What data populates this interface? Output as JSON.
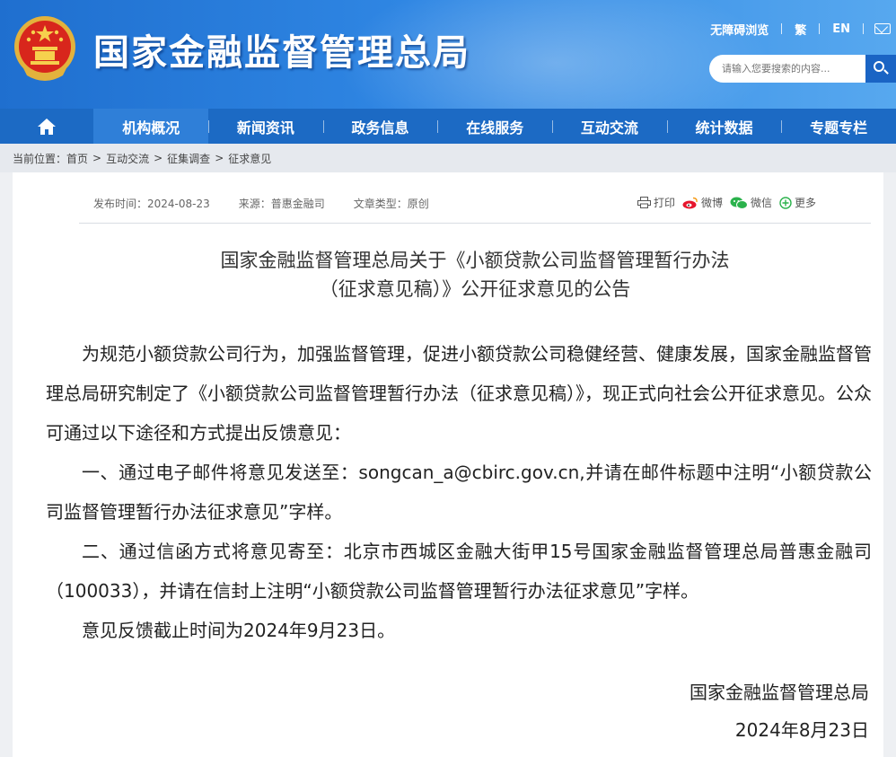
{
  "header": {
    "site_title": "国家金融监督管理总局",
    "util_links": [
      "无障碍浏览",
      "繁",
      "EN"
    ],
    "search_placeholder": "请输入您要搜索的内容..."
  },
  "nav": {
    "items": [
      "机构概况",
      "新闻资讯",
      "政务信息",
      "在线服务",
      "互动交流",
      "统计数据",
      "专题专栏"
    ],
    "active_index": 0
  },
  "breadcrumb": {
    "label": "当前位置：",
    "crumbs": [
      "首页",
      "互动交流",
      "征集调查",
      "征求意见"
    ],
    "separator": ">"
  },
  "article": {
    "meta": {
      "publish_time": "发布时间：2024-08-23",
      "source": "来源：普惠金融司",
      "type": "文章类型：原创"
    },
    "share": {
      "print": "打印",
      "weibo": "微博",
      "wechat": "微信",
      "more": "更多"
    },
    "title_line1": "国家金融监督管理总局关于《小额贷款公司监督管理暂行办法",
    "title_line2": "（征求意见稿）》公开征求意见的公告",
    "paragraphs": [
      "为规范小额贷款公司行为，加强监督管理，促进小额贷款公司稳健经营、健康发展，国家金融监督管理总局研究制定了《小额贷款公司监督管理暂行办法（征求意见稿）》，现正式向社会公开征求意见。公众可通过以下途径和方式提出反馈意见：",
      "一、通过电子邮件将意见发送至：songcan_a@cbirc.gov.cn,并请在邮件标题中注明“小额贷款公司监督管理暂行办法征求意见”字样。",
      "二、通过信函方式将意见寄至：北京市西城区金融大街甲15号国家金融监督管理总局普惠金融司（100033），并请在信封上注明“小额贷款公司监督管理暂行办法征求意见”字样。",
      "意见反馈截止时间为2024年9月23日。"
    ],
    "signature_org": "国家金融监督管理总局",
    "signature_date": "2024年8月23日"
  },
  "colors": {
    "header_blue": "#1f6fcf",
    "nav_blue": "#1c6ac4",
    "nav_active": "#2f7fd8"
  }
}
